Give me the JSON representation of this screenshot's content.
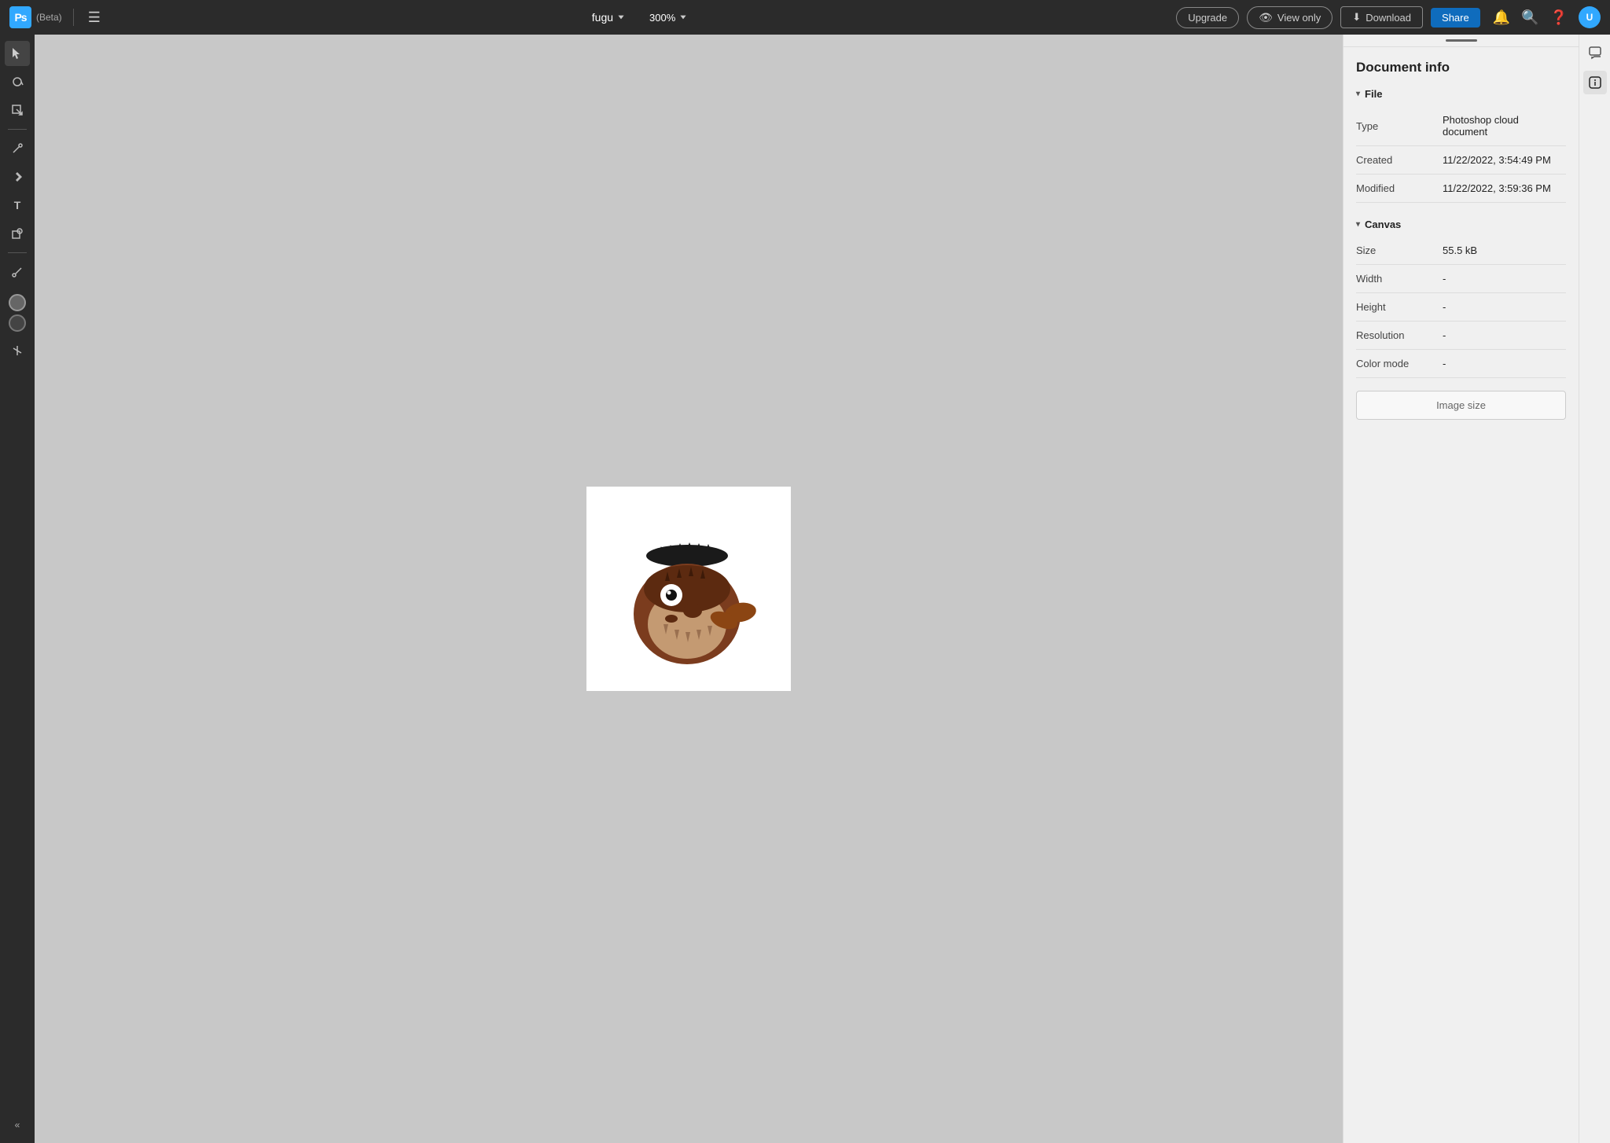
{
  "app": {
    "name": "Ps",
    "beta": "(Beta)"
  },
  "topbar": {
    "filename": "fugu",
    "zoom": "300%",
    "upgrade_label": "Upgrade",
    "viewonly_label": "View only",
    "download_label": "Download",
    "share_label": "Share"
  },
  "tools": [
    {
      "id": "select",
      "icon": "▶",
      "active": true
    },
    {
      "id": "lasso",
      "icon": "◎"
    },
    {
      "id": "transform",
      "icon": "⊞"
    },
    {
      "id": "brush",
      "icon": "✏"
    },
    {
      "id": "pen",
      "icon": "✒"
    },
    {
      "id": "text",
      "icon": "T"
    },
    {
      "id": "shape",
      "icon": "❋"
    },
    {
      "id": "eyedropper",
      "icon": "⊿"
    }
  ],
  "document_info": {
    "title": "Document info",
    "file_section": "File",
    "canvas_section": "Canvas",
    "type_label": "Type",
    "type_value": "Photoshop cloud document",
    "created_label": "Created",
    "created_value": "11/22/2022, 3:54:49 PM",
    "modified_label": "Modified",
    "modified_value": "11/22/2022, 3:59:36 PM",
    "size_label": "Size",
    "size_value": "55.5 kB",
    "width_label": "Width",
    "width_value": "-",
    "height_label": "Height",
    "height_value": "-",
    "resolution_label": "Resolution",
    "resolution_value": "-",
    "color_mode_label": "Color mode",
    "color_mode_value": "-",
    "image_size_button": "Image size"
  }
}
